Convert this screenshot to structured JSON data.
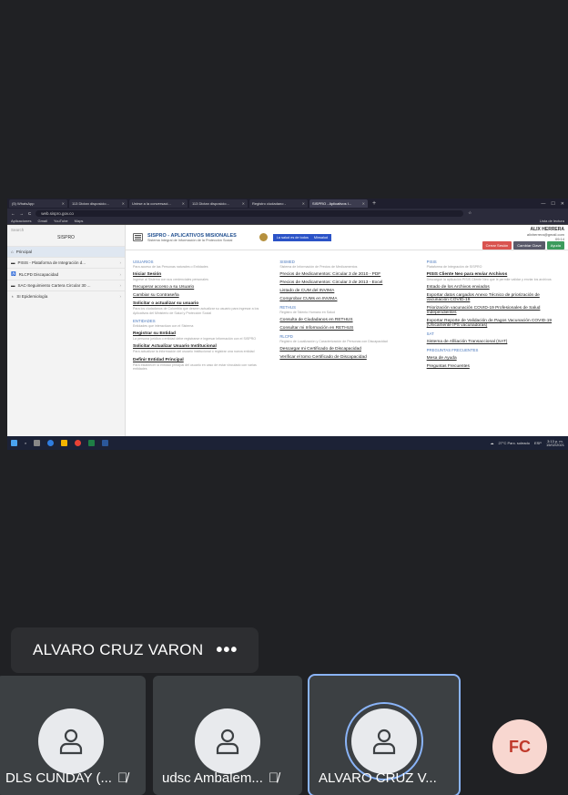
{
  "browser": {
    "tabs": [
      {
        "label": "(5) WhatsApp"
      },
      {
        "label": "113 Dictan disposicio..."
      },
      {
        "label": "Unirse a la conversaci..."
      },
      {
        "label": "113 Dictan disposicio..."
      },
      {
        "label": "Registro ciudadano -"
      },
      {
        "label": "SISPRO - Aplicativos I..."
      }
    ],
    "url": "web.sispro.gov.co",
    "bookmarks": [
      "Aplicaciones",
      "Gmail",
      "YouTube",
      "Maps"
    ],
    "reading_list": "Lista de lectura"
  },
  "sidebar": {
    "search_placeholder": "Search",
    "brand": "SISPRO",
    "items": [
      {
        "label": "Principal"
      },
      {
        "label": "PISIS - Plataforma de Integración d..."
      },
      {
        "label": "RLCPD Discapacidad"
      },
      {
        "label": "SAC-Seguimiento Cartera Circular 30 ..."
      },
      {
        "label": "SI Epidemiología"
      }
    ]
  },
  "header": {
    "title": "SISPRO - APLICATIVOS MISIONALES",
    "subtitle": "Sistema Integral de Información de la Protección Social",
    "ministry_left": "La salud es de todos",
    "ministry_right": "Minsalud",
    "user_name": "ALIX HERRERA",
    "user_email": "alixherrera@gmail.com",
    "user_time": "09:14",
    "buttons": {
      "close": "Cerrar Sesión",
      "change": "Cambiar Clave",
      "help": "Ayuda"
    }
  },
  "columns": [
    {
      "sections": [
        {
          "title": "USUARIOS",
          "sub": "Para acceso de las Personas naturales o Entidades",
          "links": [
            {
              "text": "Iniciar Sesión",
              "bold": true,
              "desc": "Ingrese al Sistema con sus credenciales personales"
            },
            {
              "text": "Recuperar acceso a su Usuario",
              "bold": false,
              "desc": ""
            },
            {
              "text": "Cambiar su Contraseña",
              "bold": false,
              "desc": ""
            },
            {
              "text": "Solicitar o actualizar su usuario",
              "bold": true,
              "desc": "Para los ciudadanos de Colombia que deseen actualizar su usuario para ingresar a los Aplicativos del Ministerio de Salud y Protección Social"
            }
          ]
        },
        {
          "title": "ENTIDADES",
          "sub": "Entidades que interactúan con el Sistema",
          "links": [
            {
              "text": "Registrar su Entidad",
              "bold": true,
              "desc": "La persona jurídica o entidad debe registrarse e ingresar información con el SISPRO"
            },
            {
              "text": "Solicitar Actualizar Usuario Institucional",
              "bold": true,
              "desc": "Para actualizar la información del usuario institucional o registrar una nueva entidad"
            },
            {
              "text": "Definir Entidad Principal",
              "bold": true,
              "desc": "Para establecer la entidad principal del usuario en caso de estar vinculado con varias entidades"
            }
          ]
        }
      ]
    },
    {
      "sections": [
        {
          "title": "SISMED",
          "sub": "Sistema de Información de Precios de Medicamentos",
          "links": [
            {
              "text": "Precios de Medicamentos: Circular 3 de 2010 - PDF",
              "bold": false,
              "desc": ""
            },
            {
              "text": "Precios de Medicamentos: Circular 3 de 2013 - Excel",
              "bold": false,
              "desc": ""
            },
            {
              "text": "Listado de CUM del INVIMA",
              "bold": false,
              "desc": ""
            },
            {
              "text": "Comprobar CUMs en INVIMA",
              "bold": false,
              "desc": ""
            }
          ]
        },
        {
          "title": "RETHUS",
          "sub": "Registro de Talento Humano en Salud",
          "links": [
            {
              "text": "Consulta de Ciudadanos en RETHUS",
              "bold": false,
              "desc": ""
            },
            {
              "text": "Consultar mi Información en RETHUS",
              "bold": false,
              "desc": ""
            }
          ]
        },
        {
          "title": "RLCPD",
          "sub": "Registro de Localización y Caracterización de Personas con Discapacidad",
          "links": [
            {
              "text": "Descargar mi Certificado de Discapacidad",
              "bold": false,
              "desc": ""
            },
            {
              "text": "Verificar el tomo Certificado de Discapacidad",
              "bold": false,
              "desc": ""
            }
          ]
        }
      ]
    },
    {
      "sections": [
        {
          "title": "PISIS",
          "sub": "Plataforma de Integración de SISPRO",
          "links": [
            {
              "text": "PISIS Cliente Neo para enviar Archivos",
              "bold": true,
              "desc": "Descargue la aplicación PISIS Cliente Neo que le permite validar y enviar los archivos"
            },
            {
              "text": "Estado de los Archivos enviados",
              "bold": false,
              "desc": ""
            },
            {
              "text": "Exportar datos cargados Anexo Técnico de priorización de vacunación COVID-19",
              "bold": false,
              "desc": ""
            },
            {
              "text": "Priorización vacunación COVID-19 Profesionales de Salud Independientes",
              "bold": false,
              "desc": ""
            },
            {
              "text": "Exportar Reporte de Validación de Pagos Vacunación COVID-19 (Únicamente IPS vacunadoras)",
              "bold": false,
              "desc": ""
            }
          ]
        },
        {
          "title": "SAT",
          "sub": "",
          "links": [
            {
              "text": "Sistema de Afiliación Transaccional (SAT)",
              "bold": false,
              "desc": ""
            }
          ]
        },
        {
          "title": "PREGUNTAS FRECUENTES",
          "sub": "",
          "links": [
            {
              "text": "Mesa de Ayuda",
              "bold": false,
              "desc": ""
            },
            {
              "text": "Preguntas Frecuentes",
              "bold": false,
              "desc": ""
            }
          ]
        }
      ]
    }
  ],
  "taskbar": {
    "weather": "27°C Parc. soleado",
    "lang": "ESP",
    "time": "3:13 p. m.",
    "date": "15/02/2021"
  },
  "meet": {
    "presenter_name": "ALVARO CRUZ VARON",
    "more_label": "•••",
    "participants": [
      {
        "name": "DLS CUNDAY (..."
      },
      {
        "name": "udsc Ambalem..."
      },
      {
        "name": "ALVARO CRUZ V..."
      }
    ],
    "extra_initials": "FC"
  }
}
